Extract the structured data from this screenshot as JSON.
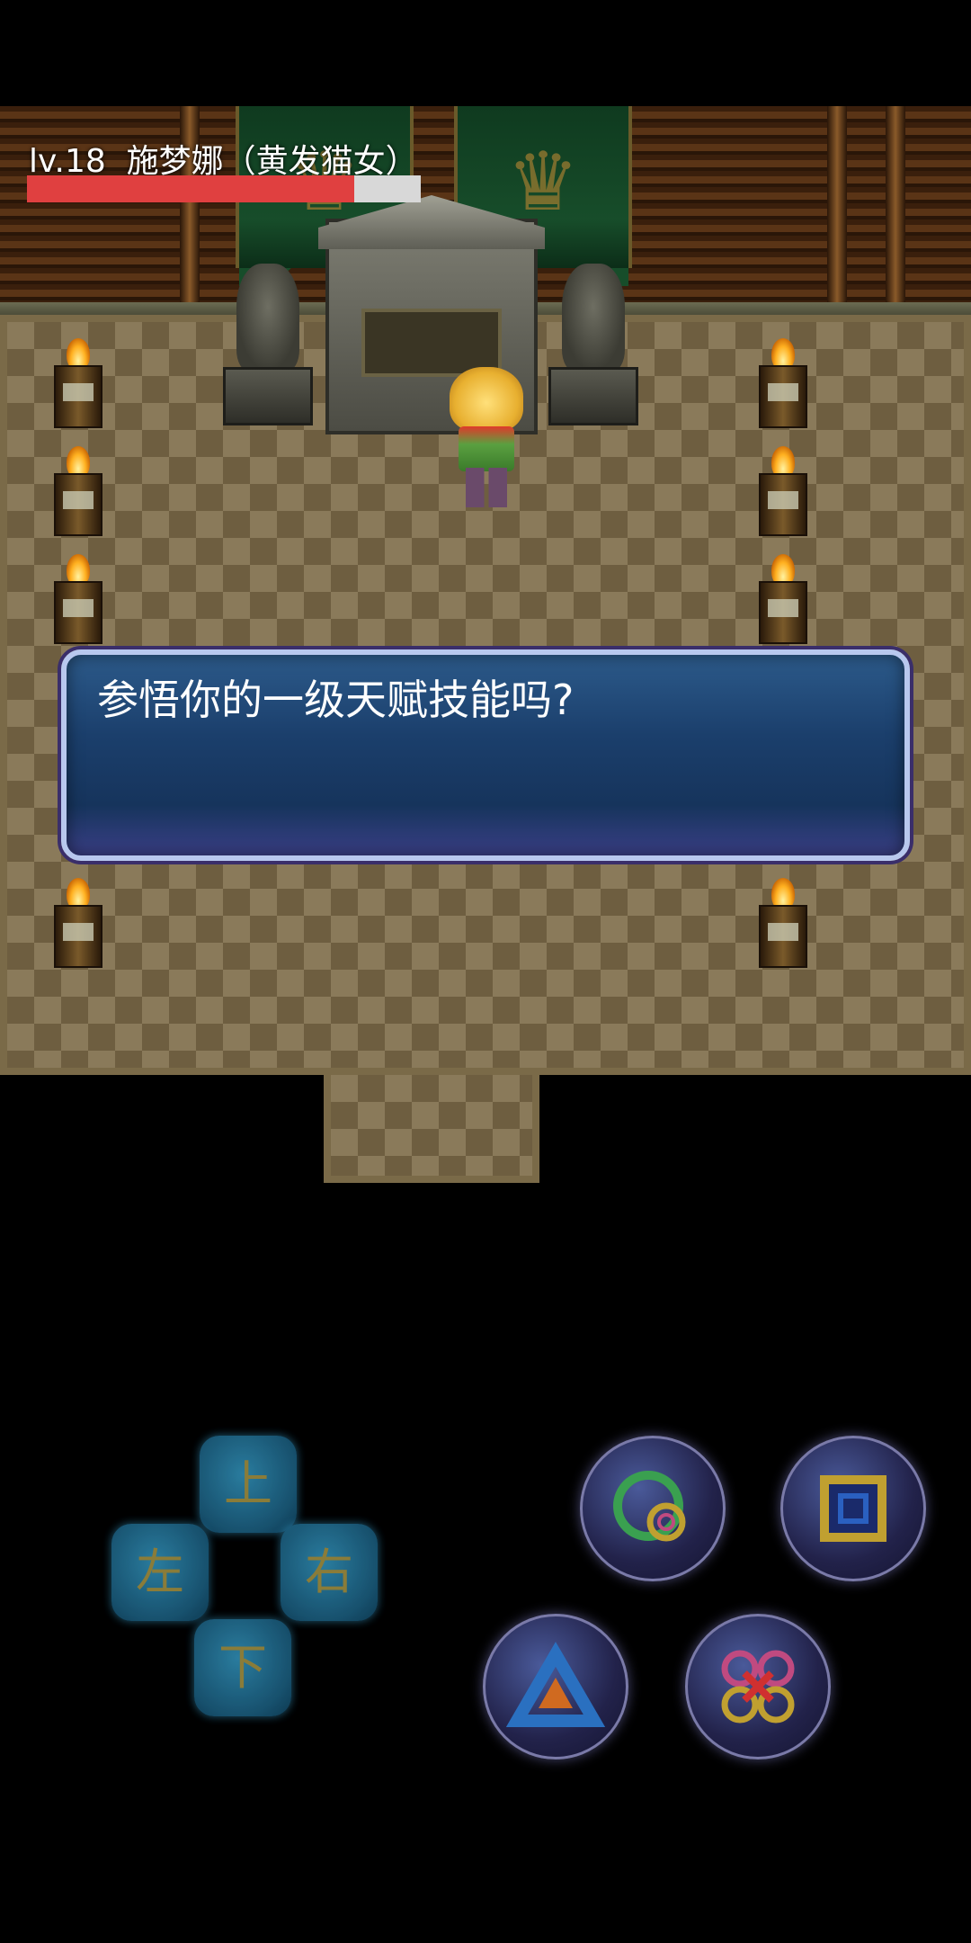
{
  "hud": {
    "level": "lv.18",
    "character_name": "施梦娜（黄发猫女）",
    "hp_fraction": 0.83,
    "hp_color": "#e04040"
  },
  "dialog": {
    "message": "参悟你的一级天赋技能吗?"
  },
  "dpad": {
    "up": "上",
    "left": "左",
    "right": "右",
    "down": "下"
  },
  "action_buttons": [
    {
      "name": "circle-button",
      "icon": "circle-icon"
    },
    {
      "name": "square-button",
      "icon": "square-icon"
    },
    {
      "name": "triangle-button",
      "icon": "triangle-icon"
    },
    {
      "name": "cross-button",
      "icon": "cross-icon"
    }
  ]
}
